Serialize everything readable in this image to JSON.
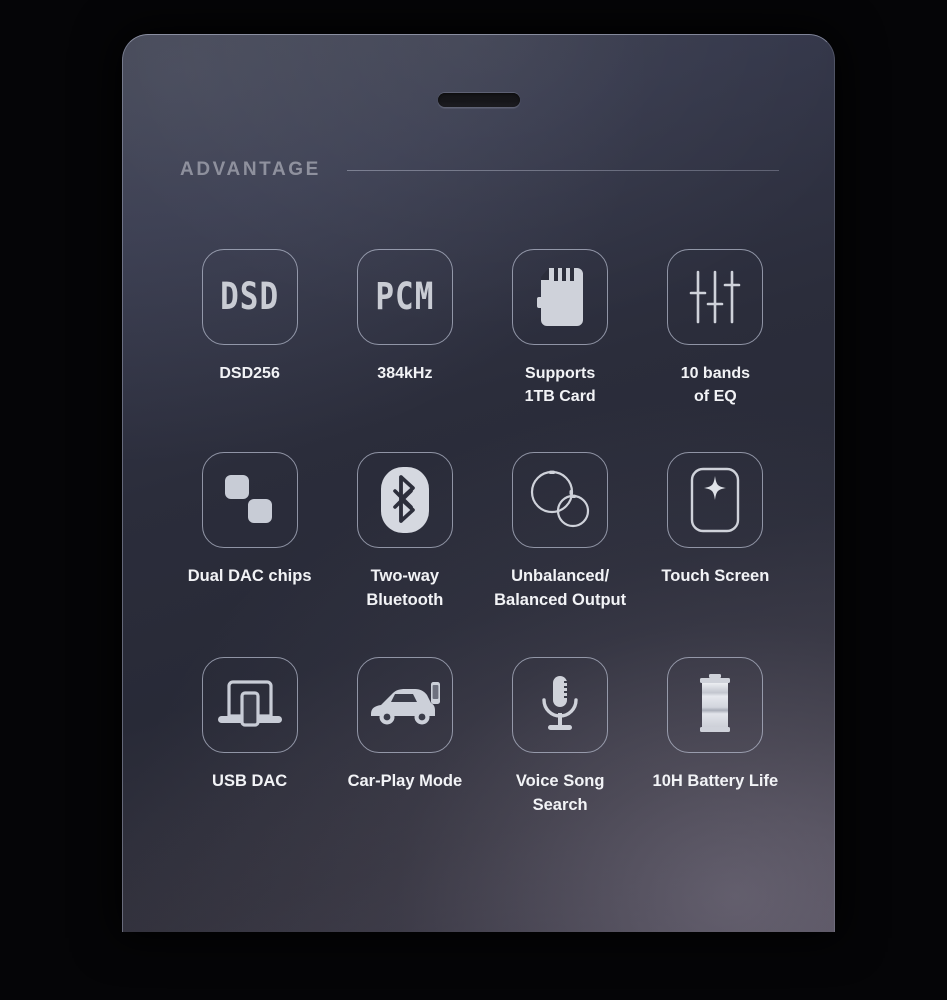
{
  "device": {
    "earpiece_label": "earpiece-speaker-slot",
    "body_color": "#2b2d3b",
    "accent_edge_color": "#bec3d7"
  },
  "section": {
    "title": "ADVANTAGE",
    "title_color": "#8d8f9c",
    "rule_color": "#aaaec0"
  },
  "features": [
    {
      "icon": "dsd-wordmark-icon",
      "icon_text": "DSD",
      "caption": "DSD256",
      "row": 1
    },
    {
      "icon": "pcm-wordmark-icon",
      "icon_text": "PCM",
      "caption": "384kHz",
      "row": 1
    },
    {
      "icon": "microsd-card-icon",
      "icon_text": "",
      "caption": "Supports\n1TB Card",
      "row": 1
    },
    {
      "icon": "equalizer-sliders-icon",
      "icon_text": "",
      "caption": "10 bands\nof EQ",
      "row": 1
    },
    {
      "icon": "dual-dac-chips-icon",
      "icon_text": "",
      "caption": "Dual DAC chips",
      "row": 2
    },
    {
      "icon": "bluetooth-icon",
      "icon_text": "",
      "caption": "Two-way\nBluetooth",
      "row": 2
    },
    {
      "icon": "audio-jacks-icon",
      "icon_text": "",
      "caption": "Unbalanced/\nBalanced Output",
      "row": 2
    },
    {
      "icon": "touch-screen-icon",
      "icon_text": "",
      "caption": "Touch Screen",
      "row": 2
    },
    {
      "icon": "laptop-usb-dac-icon",
      "icon_text": "",
      "caption": "USB DAC",
      "row": 3
    },
    {
      "icon": "car-play-icon",
      "icon_text": "",
      "caption": "Car-Play Mode",
      "row": 3
    },
    {
      "icon": "microphone-icon",
      "icon_text": "",
      "caption": "Voice Song\nSearch",
      "row": 3
    },
    {
      "icon": "battery-icon",
      "icon_text": "",
      "caption": "10H Battery Life",
      "row": 3
    }
  ]
}
